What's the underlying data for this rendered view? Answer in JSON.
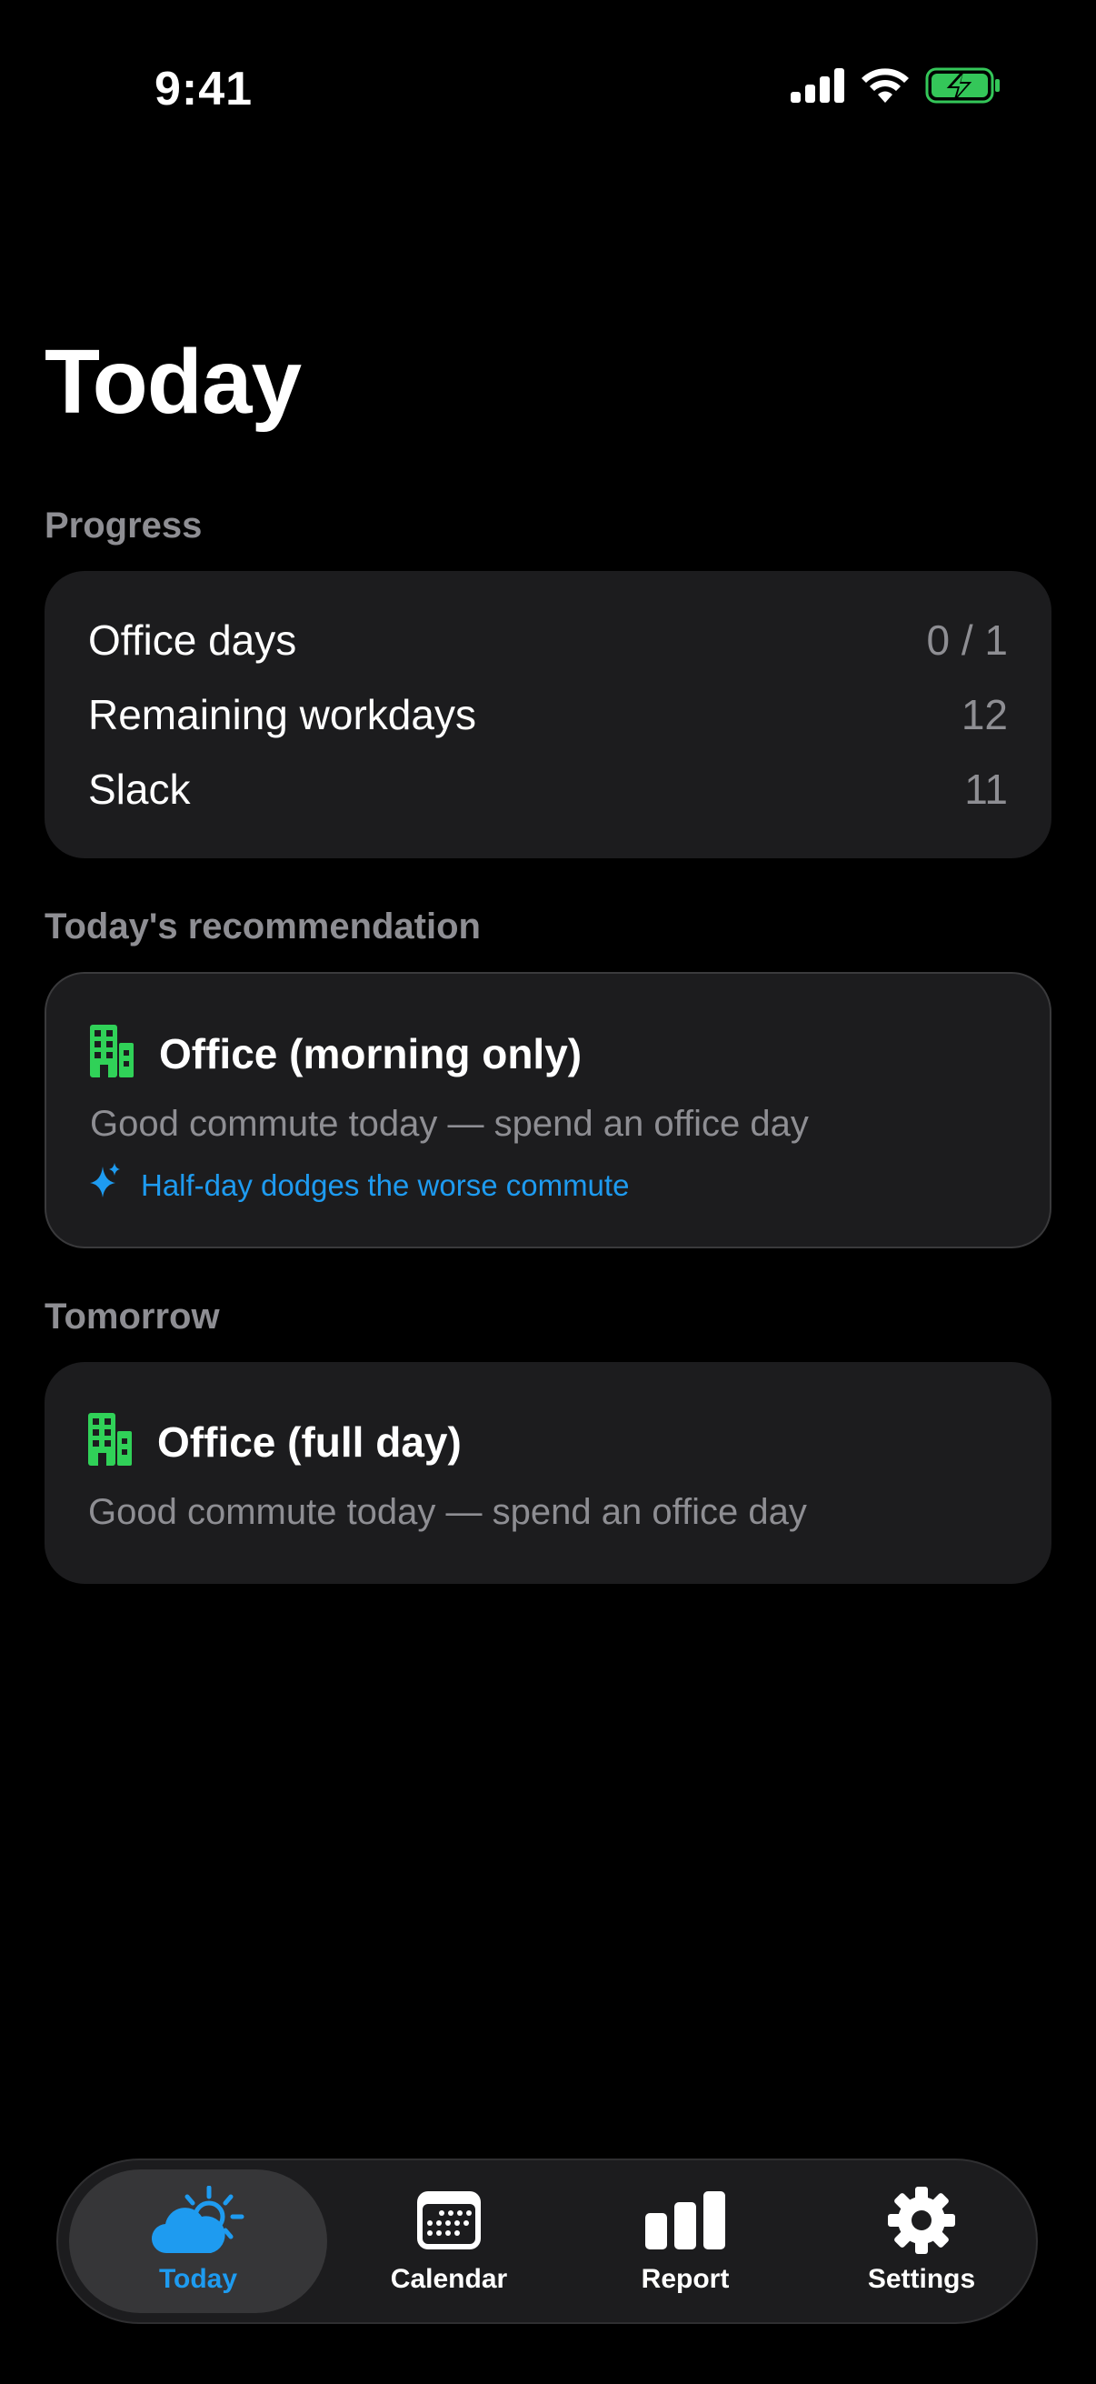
{
  "status_bar": {
    "time": "9:41",
    "icons": [
      "cellular-signal-icon",
      "wifi-icon",
      "battery-charging-icon"
    ]
  },
  "page": {
    "title": "Today"
  },
  "progress": {
    "header": "Progress",
    "rows": [
      {
        "label": "Office days",
        "value": "0 / 1"
      },
      {
        "label": "Remaining workdays",
        "value": "12"
      },
      {
        "label": "Slack",
        "value": "11"
      }
    ]
  },
  "recommendation": {
    "header": "Today's recommendation",
    "icon": "office-building-icon",
    "title": "Office (morning only)",
    "subtitle": "Good commute today — spend an office day",
    "hint_icon": "sparkle-icon",
    "hint": "Half-day dodges the worse commute"
  },
  "tomorrow": {
    "header": "Tomorrow",
    "icon": "office-building-icon",
    "title": "Office (full day)",
    "subtitle": "Good commute today — spend an office day"
  },
  "tabbar": {
    "tabs": [
      {
        "label": "Today",
        "icon": "partly-cloudy-icon",
        "active": true
      },
      {
        "label": "Calendar",
        "icon": "calendar-icon",
        "active": false
      },
      {
        "label": "Report",
        "icon": "bar-chart-icon",
        "active": false
      },
      {
        "label": "Settings",
        "icon": "gear-icon",
        "active": false
      }
    ]
  },
  "colors": {
    "background": "#000000",
    "card": "#1c1c1e",
    "secondary_text": "#8e8e93",
    "accent": "#1e9bf0",
    "building_green": "#30d158",
    "battery_green": "#34c759"
  }
}
